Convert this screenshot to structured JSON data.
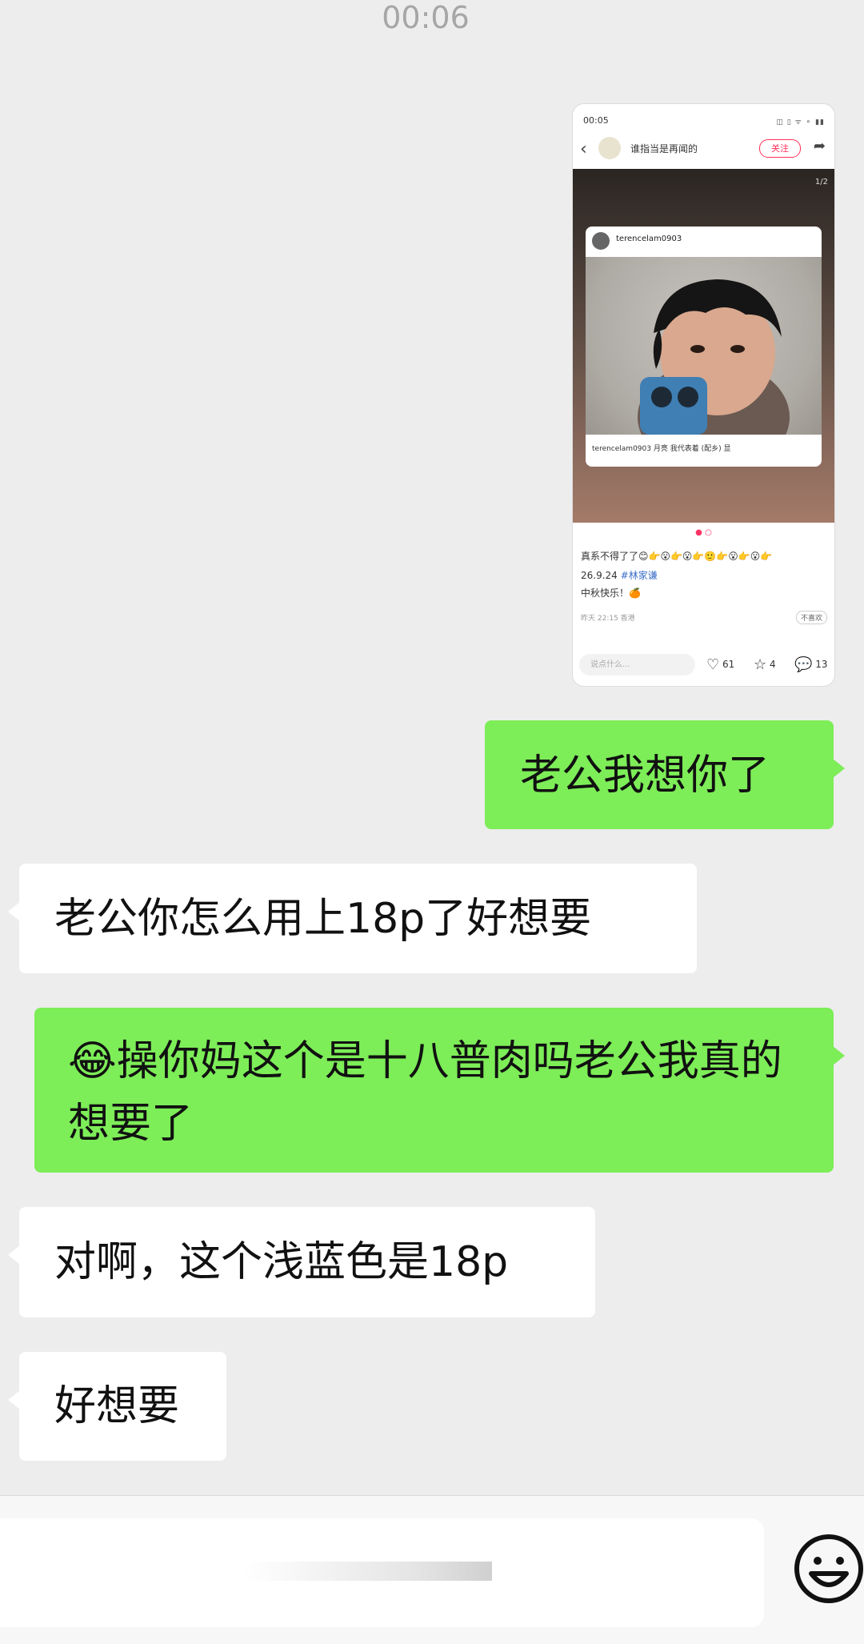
{
  "timestamp": "00:06",
  "image_message": {
    "status_time": "00:05",
    "status_icons": "◫ ▯ ᯤ ⚬ ▮▮",
    "header": {
      "account_name": "谁指当是再闻的",
      "follow_label": "关注"
    },
    "media_counter": "1/2",
    "instagram_post": {
      "username": "terencelam0903",
      "caption": "terencelam0903 月亮 我代表着 (配乡) 显"
    },
    "body_line1": "真系不得了了😊👉😮👉😮👉🙂👉😮👉😮👉",
    "body_date": "26.9.24",
    "body_hashtag": "#林家谦",
    "body_line3": "中秋快乐！🍊",
    "meta": "昨天 22:15 香港",
    "not_interested": "不喜欢",
    "comment_placeholder": "说点什么...",
    "likes": "61",
    "stars": "4",
    "comments": "13",
    "like_icon": "heart-icon",
    "star_icon": "star-icon",
    "comment_icon": "comment-icon"
  },
  "messages": [
    {
      "direction": "out",
      "text": "老公我想你了"
    },
    {
      "direction": "in",
      "text": "老公你怎么用上18p了好想要"
    },
    {
      "direction": "out",
      "emoji": "😂",
      "text": "操你妈这个是十八普肉吗老公我真的想要了"
    },
    {
      "direction": "in",
      "text": "对啊，这个浅蓝色是18p"
    },
    {
      "direction": "in",
      "text": "好想要"
    }
  ],
  "input_bar": {
    "value": "",
    "emoji_button_icon": "smiley-face-icon"
  },
  "colors": {
    "background": "#ededed",
    "outgoing_bubble": "#7ded58",
    "incoming_bubble": "#ffffff",
    "follow_accent": "#ff2d55"
  }
}
